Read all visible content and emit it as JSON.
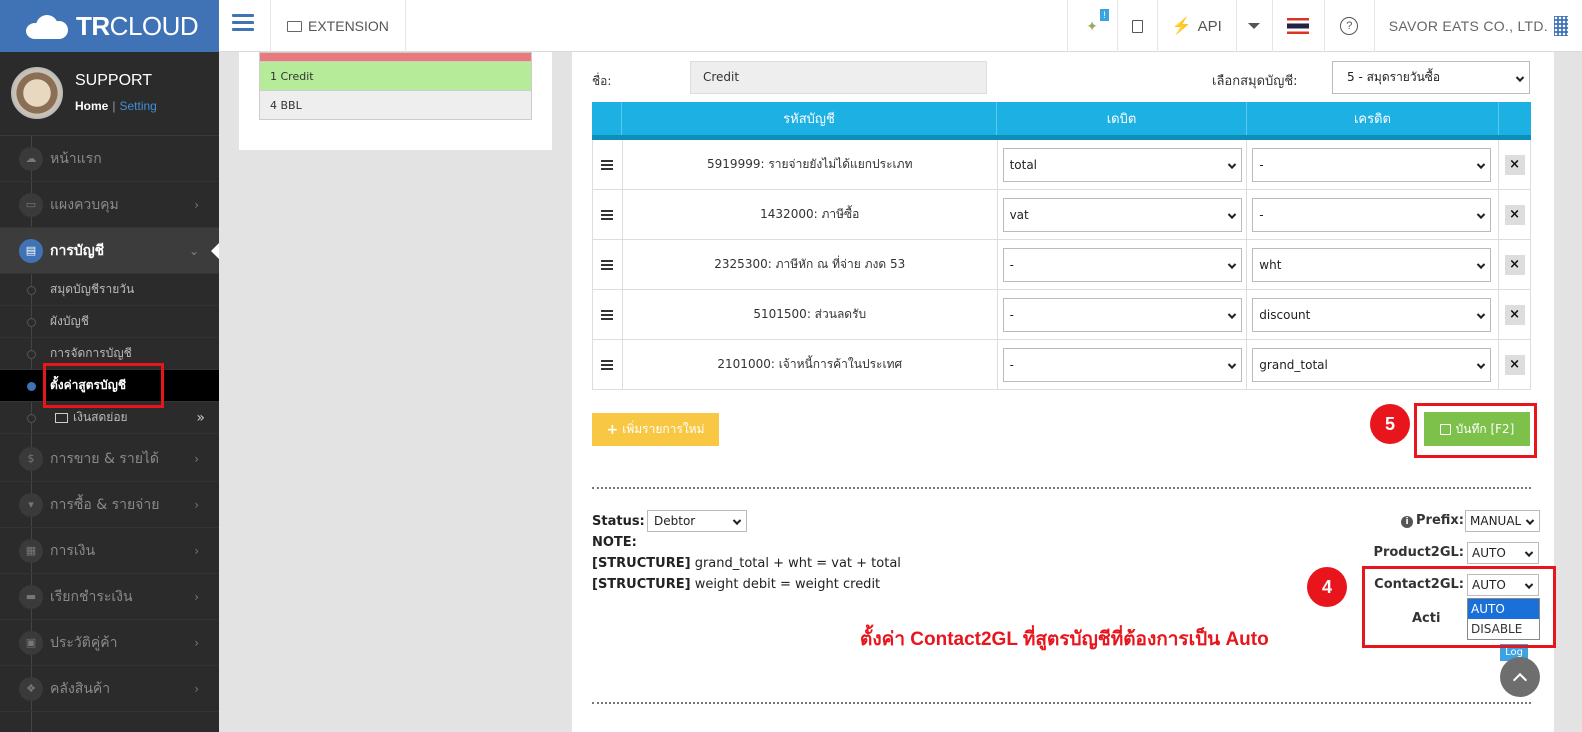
{
  "topbar": {
    "logo_bold": "TR",
    "logo_light": "CLOUD",
    "extension_label": "EXTENSION",
    "notif_count": "!",
    "api_label": "API",
    "company": "SAVOR EATS CO., LTD."
  },
  "profile": {
    "name": "SUPPORT",
    "home": "Home",
    "sep": "|",
    "setting": "Setting"
  },
  "sidebar": {
    "items": [
      {
        "label": "หน้าแรก",
        "icon": "cloud-icon"
      },
      {
        "label": "แผงควบคุม",
        "icon": "monitor-icon"
      },
      {
        "label": "การบัญชี",
        "icon": "book-icon"
      },
      {
        "label": "การขาย & รายได้",
        "icon": "dollar-icon"
      },
      {
        "label": "การซื้อ & รายจ่าย",
        "icon": "cart-icon"
      },
      {
        "label": "การเงิน",
        "icon": "calendar-icon"
      },
      {
        "label": "เรียกชำระเงิน",
        "icon": "card-icon"
      },
      {
        "label": "ประวัติคู่ค้า",
        "icon": "contact-icon"
      },
      {
        "label": "คลังสินค้า",
        "icon": "cubes-icon"
      }
    ],
    "subitems": [
      {
        "label": "สมุดบัญชีรายวัน"
      },
      {
        "label": "ผังบัญชี"
      },
      {
        "label": "การจัดการบัญชี"
      },
      {
        "label": "ตั้งค่าสูตรบัญชี"
      },
      {
        "label": "เงินสดย่อย"
      }
    ]
  },
  "list": {
    "rows": [
      "1 Credit",
      "4 BBL"
    ]
  },
  "form": {
    "name_label": "ชื่อ:",
    "name_value": "Credit",
    "journal_label": "เลือกสมุดบัญชี:",
    "journal_value": "5 - สมุดรายวันซื้อ"
  },
  "table": {
    "headers": [
      "รหัสบัญชี",
      "เดบิต",
      "เครดิต"
    ],
    "rows": [
      {
        "account": "5919999: รายจ่ายยังไม่ได้แยกประเภท",
        "debit": "total",
        "credit": "-"
      },
      {
        "account": "1432000: ภาษีซื้อ",
        "debit": "vat",
        "credit": "-"
      },
      {
        "account": "2325300: ภาษีหัก ณ ที่จ่าย ภงด 53",
        "debit": "-",
        "credit": "wht"
      },
      {
        "account": "5101500: ส่วนลดรับ",
        "debit": "-",
        "credit": "discount"
      },
      {
        "account": "2101000: เจ้าหนี้การค้าในประเทศ",
        "debit": "-",
        "credit": "grand_total"
      }
    ]
  },
  "buttons": {
    "add": "เพิ่มรายการใหม่",
    "save": "บันทึก [F2]",
    "log": "Log"
  },
  "status": {
    "label": "Status:",
    "value": "Debtor",
    "note_label": "NOTE:",
    "structure_tag_1": "[STRUCTURE]",
    "structure_text_1": "grand_total + wht = vat + total",
    "structure_tag_2": "[STRUCTURE]",
    "structure_text_2": "weight debit = weight credit"
  },
  "settings": {
    "prefix_label": "Prefix:",
    "prefix_value": "MANUAL",
    "product2gl_label": "Product2GL:",
    "product2gl_value": "AUTO",
    "contact2gl_label": "Contact2GL:",
    "contact2gl_value": "AUTO",
    "contact2gl_options": [
      "AUTO",
      "DISABLE"
    ],
    "active_label": "Acti"
  },
  "annotation": {
    "step4": "4",
    "step5": "5",
    "text": "ตั้งค่า Contact2GL ที่สูตรบัญชีที่ต้องการเป็น Auto",
    "color": "#e8151d"
  }
}
